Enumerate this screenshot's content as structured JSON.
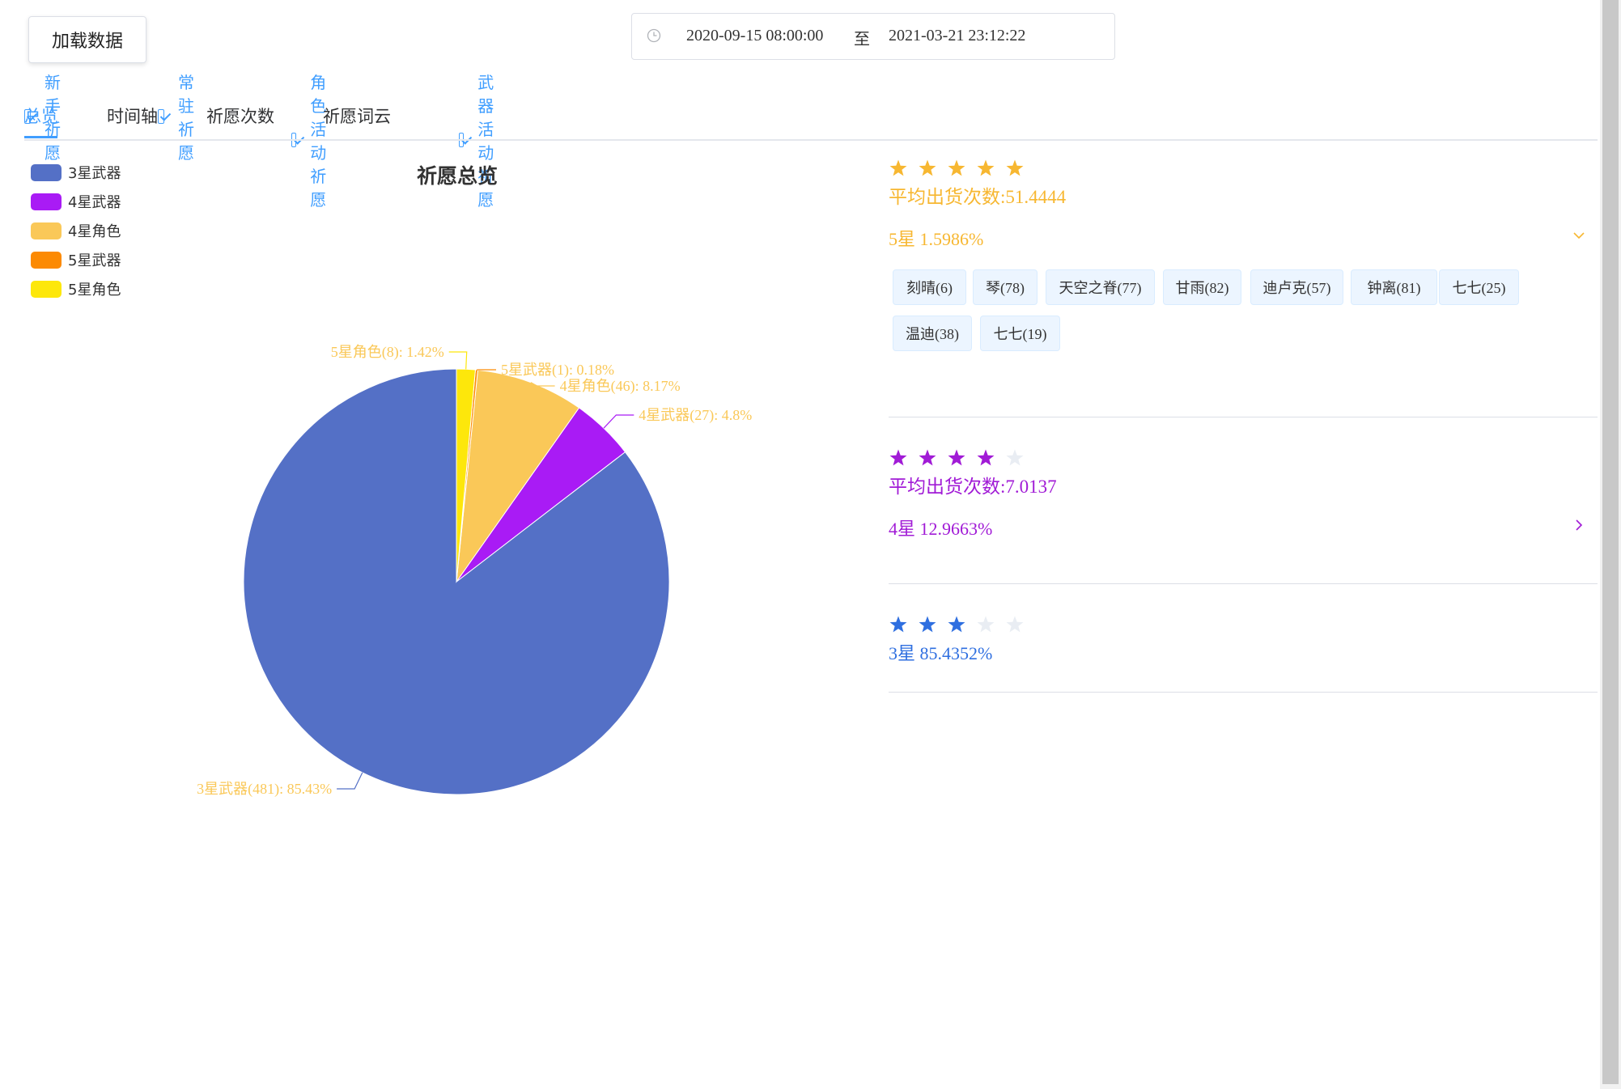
{
  "toolbar": {
    "load_label": "加载数据"
  },
  "date_range": {
    "start": "2020-09-15 08:00:00",
    "separator": "至",
    "end": "2021-03-21 23:12:22"
  },
  "filters": [
    {
      "label": "新手祈愿",
      "checked": true
    },
    {
      "label": "常驻祈愿",
      "checked": true
    },
    {
      "label": "角色活动祈愿",
      "checked": true
    },
    {
      "label": "武器活动祈愿",
      "checked": true
    }
  ],
  "tabs": [
    {
      "label": "总览",
      "active": true
    },
    {
      "label": "时间轴",
      "active": false
    },
    {
      "label": "祈愿次数",
      "active": false
    },
    {
      "label": "祈愿词云",
      "active": false
    }
  ],
  "chart_data": {
    "type": "pie",
    "title": "祈愿总览",
    "legend_position": "top-left",
    "categories": [
      "3星武器",
      "4星武器",
      "4星角色",
      "5星武器",
      "5星角色"
    ],
    "values": [
      481,
      27,
      46,
      1,
      8
    ],
    "percents": [
      85.43,
      4.8,
      8.17,
      0.18,
      1.42
    ],
    "colors": [
      "#5470c6",
      "#a91bf5",
      "#fac858",
      "#fc8a03",
      "#fde70b"
    ],
    "labels": [
      "3星武器(481): 85.43%",
      "4星武器(27): 4.8%",
      "4星角色(46): 8.17%",
      "5星武器(1): 0.18%",
      "5星角色(8): 1.42%"
    ]
  },
  "ranks": [
    {
      "stars": 5,
      "color": "#f7b731",
      "avg": "平均出货次数:51.4444",
      "percent": "5星 1.5986%",
      "expanded": true,
      "tags": [
        "刻晴(6)",
        "琴(78)",
        "天空之脊(77)",
        "甘雨(82)",
        "迪卢克(57)",
        "钟离(81)",
        "七七(25)",
        "温迪(38)",
        "七七(19)"
      ]
    },
    {
      "stars": 4,
      "color": "#a11bd6",
      "avg": "平均出货次数:7.0137",
      "percent": "4星 12.9663%",
      "expanded": false
    },
    {
      "stars": 3,
      "color": "#2f6fe0",
      "percent": "3星 85.4352%"
    }
  ],
  "colors": {
    "accent": "#409eff",
    "star_empty": "#e9edf3"
  }
}
